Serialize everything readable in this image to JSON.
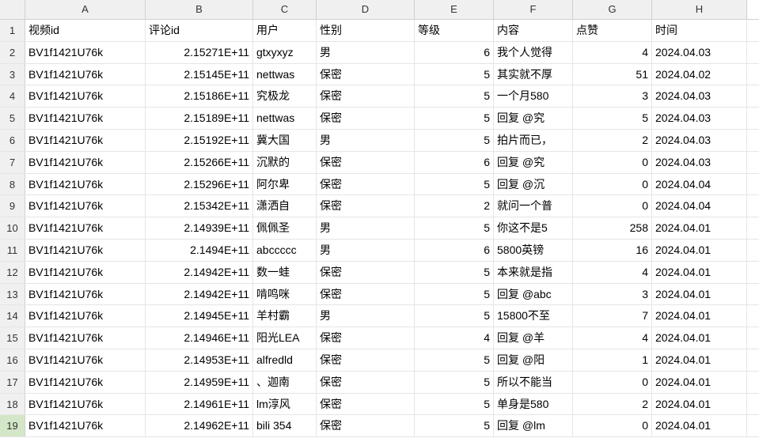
{
  "columnHeaders": [
    "A",
    "B",
    "C",
    "D",
    "E",
    "F",
    "G",
    "H"
  ],
  "rowNumbers": [
    1,
    2,
    3,
    4,
    5,
    6,
    7,
    8,
    9,
    10,
    11,
    12,
    13,
    14,
    15,
    16,
    17,
    18,
    19
  ],
  "selectedRow": 19,
  "headers": {
    "a": "视频id",
    "b": "评论id",
    "c": "用户",
    "d": "性别",
    "e": "等级",
    "f": "内容",
    "g": "点赞",
    "h": "时间"
  },
  "rows": [
    {
      "a": "BV1f1421U76k",
      "b": "2.15271E+11",
      "c": "gtxyxyz",
      "d": "男",
      "e": "6",
      "f": "我个人觉得",
      "g": "4",
      "h": "2024.04.03"
    },
    {
      "a": "BV1f1421U76k",
      "b": "2.15145E+11",
      "c": "nettwas",
      "d": "保密",
      "e": "5",
      "f": "其实就不厚",
      "g": "51",
      "h": "2024.04.02"
    },
    {
      "a": "BV1f1421U76k",
      "b": "2.15186E+11",
      "c": "究极龙",
      "d": "保密",
      "e": "5",
      "f": "一个月580",
      "g": "3",
      "h": "2024.04.03"
    },
    {
      "a": "BV1f1421U76k",
      "b": "2.15189E+11",
      "c": "nettwas",
      "d": "保密",
      "e": "5",
      "f": "回复 @究",
      "g": "5",
      "h": "2024.04.03"
    },
    {
      "a": "BV1f1421U76k",
      "b": "2.15192E+11",
      "c": "冀大国",
      "d": "男",
      "e": "5",
      "f": "拍片而已，",
      "g": "2",
      "h": "2024.04.03"
    },
    {
      "a": "BV1f1421U76k",
      "b": "2.15266E+11",
      "c": "沉默的",
      "d": "保密",
      "e": "6",
      "f": "回复 @究",
      "g": "0",
      "h": "2024.04.03"
    },
    {
      "a": "BV1f1421U76k",
      "b": "2.15296E+11",
      "c": "阿尔卑",
      "d": "保密",
      "e": "5",
      "f": "回复 @沉",
      "g": "0",
      "h": "2024.04.04"
    },
    {
      "a": "BV1f1421U76k",
      "b": "2.15342E+11",
      "c": "潇洒自",
      "d": "保密",
      "e": "2",
      "f": "就问一个普",
      "g": "0",
      "h": "2024.04.04"
    },
    {
      "a": "BV1f1421U76k",
      "b": "2.14939E+11",
      "c": "佩佩圣",
      "d": "男",
      "e": "5",
      "f": "你这不是5",
      "g": "258",
      "h": "2024.04.01"
    },
    {
      "a": "BV1f1421U76k",
      "b": "2.1494E+11",
      "c": "abccccc",
      "d": "男",
      "e": "6",
      "f": "5800英镑",
      "g": "16",
      "h": "2024.04.01"
    },
    {
      "a": "BV1f1421U76k",
      "b": "2.14942E+11",
      "c": "数一蛙",
      "d": "保密",
      "e": "5",
      "f": "本来就是指",
      "g": "4",
      "h": "2024.04.01"
    },
    {
      "a": "BV1f1421U76k",
      "b": "2.14942E+11",
      "c": "啃鸣咪",
      "d": "保密",
      "e": "5",
      "f": "回复 @abc",
      "g": "3",
      "h": "2024.04.01"
    },
    {
      "a": "BV1f1421U76k",
      "b": "2.14945E+11",
      "c": "羊村霸",
      "d": "男",
      "e": "5",
      "f": "15800不至",
      "g": "7",
      "h": "2024.04.01"
    },
    {
      "a": "BV1f1421U76k",
      "b": "2.14946E+11",
      "c": "阳光LEA",
      "d": "保密",
      "e": "4",
      "f": "回复 @羊",
      "g": "4",
      "h": "2024.04.01"
    },
    {
      "a": "BV1f1421U76k",
      "b": "2.14953E+11",
      "c": "alfredld",
      "d": "保密",
      "e": "5",
      "f": "回复 @阳",
      "g": "1",
      "h": "2024.04.01"
    },
    {
      "a": "BV1f1421U76k",
      "b": "2.14959E+11",
      "c": "、迦南",
      "d": "保密",
      "e": "5",
      "f": "所以不能当",
      "g": "0",
      "h": "2024.04.01"
    },
    {
      "a": "BV1f1421U76k",
      "b": "2.14961E+11",
      "c": "lm淳风",
      "d": "保密",
      "e": "5",
      "f": "单身是580",
      "g": "2",
      "h": "2024.04.01"
    },
    {
      "a": "BV1f1421U76k",
      "b": "2.14962E+11",
      "c": "bili 354",
      "d": "保密",
      "e": "5",
      "f": "回复 @lm",
      "g": "0",
      "h": "2024.04.01"
    }
  ]
}
